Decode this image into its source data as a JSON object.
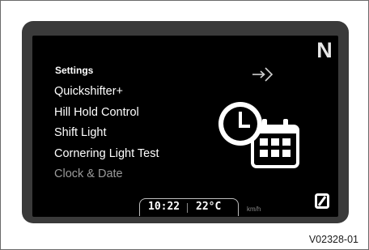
{
  "screen": {
    "gear_indicator": "N",
    "menu": {
      "title": "Settings",
      "items": [
        {
          "label": "Quickshifter+",
          "dimmed": false
        },
        {
          "label": "Hill Hold Control",
          "dimmed": false
        },
        {
          "label": "Shift Light",
          "dimmed": false
        },
        {
          "label": "Cornering Light Test",
          "dimmed": false
        },
        {
          "label": "Clock & Date",
          "dimmed": true
        }
      ]
    },
    "icons": {
      "enter": "enter-arrow-icon",
      "feature": "clock-calendar-icon",
      "ride_mode": "ride-mode-icon"
    },
    "status_bar": {
      "time": "10:22",
      "temperature": "22°C",
      "speed_unit": "km/h"
    }
  },
  "figure_caption": "V02328-01",
  "colors": {
    "screen_background": "#000000",
    "bezel": "#3a3a3a",
    "text_primary": "#ffffff",
    "text_dimmed": "#9a9a9a"
  }
}
